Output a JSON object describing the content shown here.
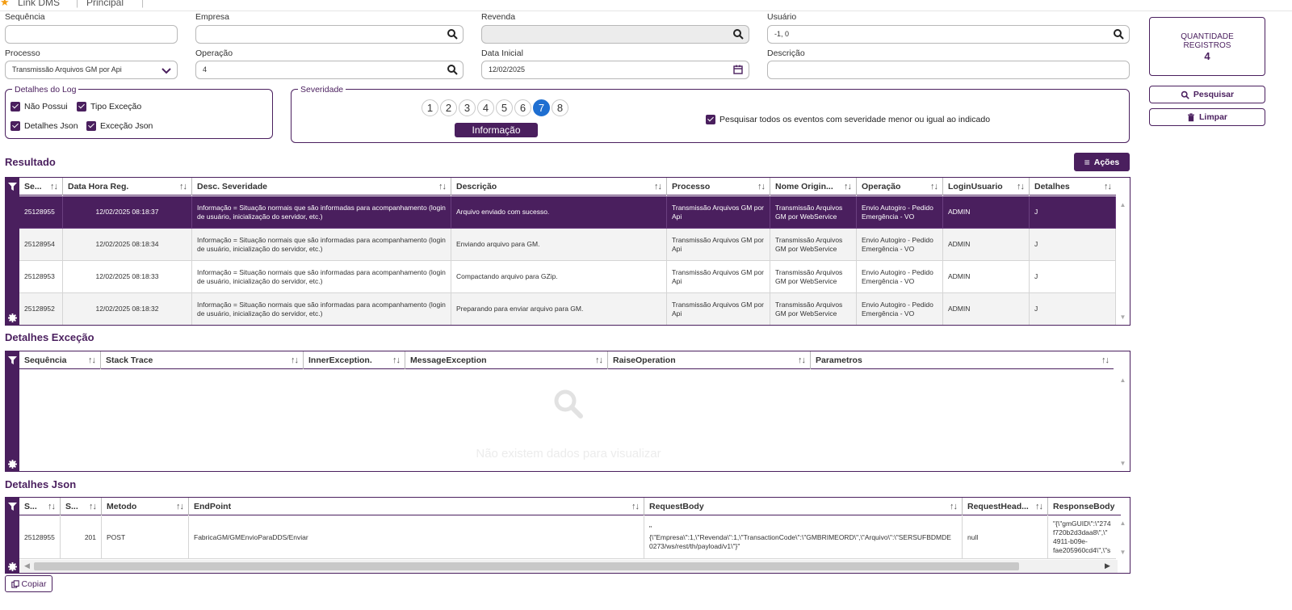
{
  "topbar": {
    "app": "Link DMS",
    "sep": "|",
    "module": "Principal"
  },
  "form": {
    "sequencia": {
      "label": "Sequência",
      "value": ""
    },
    "empresa": {
      "label": "Empresa",
      "value": ""
    },
    "revenda": {
      "label": "Revenda",
      "value": ""
    },
    "usuario": {
      "label": "Usuário",
      "value": "-1, 0"
    },
    "processo": {
      "label": "Processo",
      "value": "Transmissão Arquivos GM por Api"
    },
    "operacao": {
      "label": "Operação",
      "value": "4"
    },
    "data_inicial": {
      "label": "Data Inicial",
      "value": "12/02/2025"
    },
    "descricao": {
      "label": "Descrição",
      "value": ""
    }
  },
  "detalhes_log": {
    "legend": "Detalhes do Log",
    "checks": [
      "Não Possui",
      "Tipo Exceção",
      "Detalhes Json",
      "Exceção Json"
    ]
  },
  "severidade": {
    "legend": "Severidade",
    "levels": [
      "1",
      "2",
      "3",
      "4",
      "5",
      "6",
      "7",
      "8"
    ],
    "selected": "7",
    "selected_label": "Informação",
    "all_lower_label": "Pesquisar todos os eventos com severidade menor ou igual ao indicado"
  },
  "side": {
    "qty_title_1": "QUANTIDADE",
    "qty_title_2": "REGISTROS",
    "qty_value": "4",
    "search": "Pesquisar",
    "clear": "Limpar"
  },
  "resultado": {
    "title": "Resultado",
    "actions": "Ações",
    "columns": [
      "Se...",
      "Data Hora Reg.",
      "Desc. Severidade",
      "Descrição",
      "Processo",
      "Nome Origin...",
      "Operação",
      "LoginUsuario",
      "Detalhes"
    ],
    "rows": [
      [
        "25128955",
        "12/02/2025 08:18:37",
        "Informação = Situação normais que são informadas para acompanhamento (login de usuário, inicialização do servidor, etc.)",
        "Arquivo enviado com sucesso.",
        "Transmissão Arquivos GM por Api",
        "Transmissão Arquivos GM por WebService",
        "Envio Autogiro - Pedido Emergência - VO",
        "ADMIN",
        "J"
      ],
      [
        "25128954",
        "12/02/2025 08:18:34",
        "Informação = Situação normais que são informadas para acompanhamento (login de usuário, inicialização do servidor, etc.)",
        "Enviando arquivo para GM.",
        "Transmissão Arquivos GM por Api",
        "Transmissão Arquivos GM por WebService",
        "Envio Autogiro - Pedido Emergência - VO",
        "ADMIN",
        "J"
      ],
      [
        "25128953",
        "12/02/2025 08:18:33",
        "Informação = Situação normais que são informadas para acompanhamento (login de usuário, inicialização do servidor, etc.)",
        "Compactando arquivo para GZip.",
        "Transmissão Arquivos GM por Api",
        "Transmissão Arquivos GM por WebService",
        "Envio Autogiro - Pedido Emergência - VO",
        "ADMIN",
        "J"
      ],
      [
        "25128952",
        "12/02/2025 08:18:32",
        "Informação = Situação normais que são informadas para acompanhamento (login de usuário, inicialização do servidor, etc.)",
        "Preparando para enviar arquivo para GM.",
        "Transmissão Arquivos GM por Api",
        "Transmissão Arquivos GM por WebService",
        "Envio Autogiro - Pedido Emergência - VO",
        "ADMIN",
        "J"
      ]
    ]
  },
  "excecao": {
    "title": "Detalhes Exceção",
    "columns": [
      "Sequência",
      "Stack Trace",
      "InnerException.",
      "MessageException",
      "RaiseOperation",
      "Parametros"
    ],
    "empty": "Não existem dados para visualizar"
  },
  "json": {
    "title": "Detalhes Json",
    "columns": [
      "S...",
      "S...",
      "Metodo",
      "EndPoint",
      "RequestBody",
      "RequestHead...",
      "ResponseBody"
    ],
    "row": {
      "seq": "25128955",
      "status": "201",
      "metodo": "POST",
      "endpoint": "FabricaGM/GMEnvioParaDDS/Enviar",
      "body_1": "\"",
      "body_2": "{\\\"Empresa\\\":1,\\\"Revenda\\\":1,\\\"TransactionCode\\\":\\\"GMBRIMEORD\\\",\\\"Arquivo\\\":\\\"SERSUFBDMDE",
      "body_3": "0273/ws/rest/th/payload/v1\\\"}\"",
      "head": "null",
      "resp_1": "\"{\\\"gmGUID\\\":\\\"274",
      "resp_2": "f720b2d3daa8\\\",\\\"",
      "resp_3": "4911-b09e-",
      "resp_4": "fae205960cd4\\\",\\\"s"
    },
    "copy": "Copiar"
  }
}
